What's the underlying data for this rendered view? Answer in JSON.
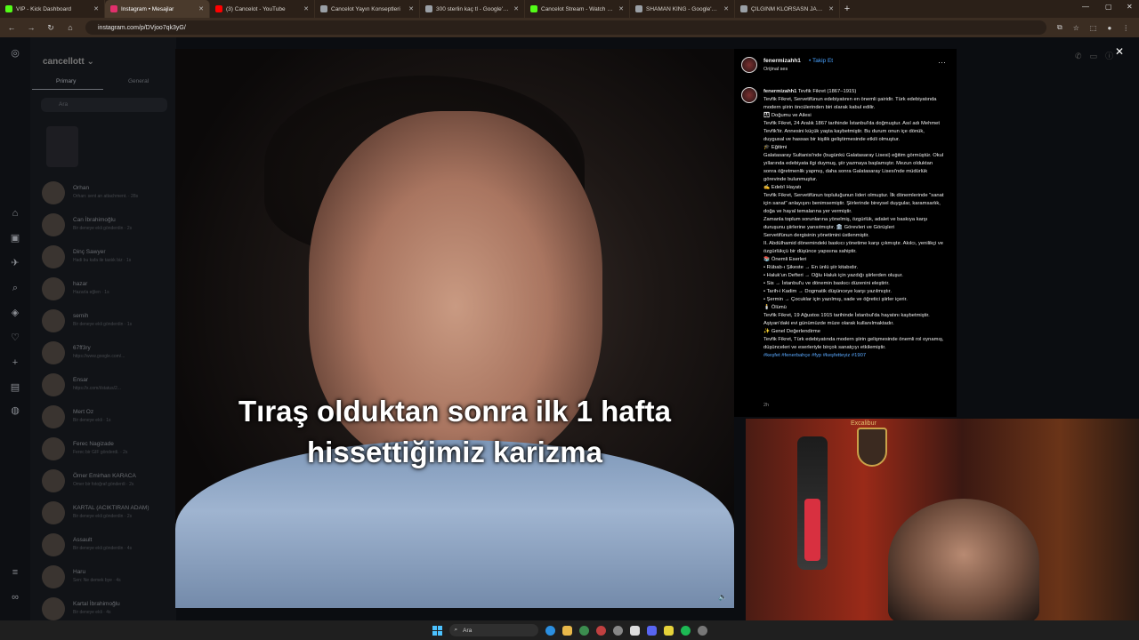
{
  "browser": {
    "tabs": [
      {
        "label": "VIP - Kick Dashboard",
        "color": "#53fc18"
      },
      {
        "label": "Instagram • Mesajlar",
        "color": "#e1306c",
        "active": true
      },
      {
        "label": "(3) Cancelot - YouTube",
        "color": "#ff0000"
      },
      {
        "label": "Cancelot Yayın Konseptleri",
        "color": "#9aa0a6"
      },
      {
        "label": "300 sterlin kaç tl - Google'da Ara",
        "color": "#9aa0a6"
      },
      {
        "label": "Cancelot Stream - Watch Live o",
        "color": "#53fc18"
      },
      {
        "label": "SHAMAN KING - Google'da Ara",
        "color": "#9aa0a6"
      },
      {
        "label": "ÇILGINM KLORSASN JACK - Go",
        "color": "#9aa0a6"
      }
    ],
    "url": "instagram.com/p/DVjoo7qk3yG/"
  },
  "dm": {
    "username": "cancellott",
    "tabs": [
      "Primary",
      "General"
    ],
    "search_placeholder": "Ara",
    "threads": [
      {
        "name": "Orhan",
        "sub": "Orhan: sent an attachment. · 28s"
      },
      {
        "name": "Can İbrahimoğlu",
        "sub": "Bir deneye ekli gönderdin · 2s"
      },
      {
        "name": "Dinç Sawyer",
        "sub": "Hadi bu kafa ile tastık biz · 1s"
      },
      {
        "name": "hazar",
        "sub": "Hazarla eğlen · 1s"
      },
      {
        "name": "semih",
        "sub": "Bir deneye ekli gönderdin · 1s"
      },
      {
        "name": "67ff3ry",
        "sub": "https://www.google.com/..."
      },
      {
        "name": "Ensar",
        "sub": "https://x.com/i/status/2..."
      },
      {
        "name": "Mert Oz",
        "sub": "Bir deneye ekli · 1s"
      },
      {
        "name": "Ferec Nagizade",
        "sub": "Ferec bir GIF gönderdi. · 2s"
      },
      {
        "name": "Ömer Emirhan KARACA",
        "sub": "Ömer bir fotoğraf gönderdi · 2s"
      },
      {
        "name": "KARTAL (ACIKTIRAN ADAM)",
        "sub": "Bir deneye ekli gönderdin · 2s"
      },
      {
        "name": "Assault",
        "sub": "Bir deneye ekli gönderdin · 4s"
      },
      {
        "name": "Haru",
        "sub": "Sen: Ne demek bye · 4s"
      },
      {
        "name": "Kartal İbrahimoğlu",
        "sub": "Bir deneye ekli · 4s"
      }
    ]
  },
  "video": {
    "caption": "Tıraş olduktan sonra ilk 1 hafta hissettiğimiz karizma"
  },
  "post": {
    "author": "fenermizahh1",
    "follow_label": "Takip Et",
    "audio": "Orijinal ses",
    "heading": "Tevfik Fikret (1867–1915)",
    "lines": [
      "Tevfik Fikret, Servetifünun edebiyatının en önemli şairidir. Türk edebiyatında modern şiirin öncülerinden biri olarak kabul edilir.",
      "👨‍👩‍👦 Doğumu ve Ailesi",
      "Tevfik Fikret, 24 Aralık 1867 tarihinde İstanbul'da doğmuştur. Asıl adı Mehmet Tevfik'tir. Annesini küçük yaşta kaybetmiştir. Bu durum onun içe dönük, duygusal ve hassas bir kişilik geliştirmesinde etkili olmuştur.",
      "🎓 Eğitimi",
      "Galatasaray Sultanisi'nde (bugünkü Galatasaray Lisesi) eğitim görmüştür. Okul yıllarında edebiyata ilgi duymuş, şiir yazmaya başlamıştır. Mezun olduktan sonra öğretmenlik yapmış, daha sonra Galatasaray Lisesi'nde müdürlük görevinde bulunmuştur.",
      "✍️ Edebî Hayatı",
      "Tevfik Fikret, Servetifünun topluluğunun lideri olmuştur. İlk dönemlerinde \"sanat için sanat\" anlayışını benimsemiştir. Şiirlerinde bireysel duygular, karamsarlık, doğa ve hayal temalarına yer vermiştir.",
      "Zamanla toplum sorunlarına yönelmiş, özgürlük, adalet ve baskıya karşı duruşunu şiirlerine yansıtmıştır. 🏛️ Görevleri ve Görüşleri",
      "Servetifünun dergisinin yönetimini üstlenmiştir.",
      "II. Abdülhamid dönemindeki baskıcı yönetime karşı çıkmıştır. Akılcı, yenilikçi ve özgürlükçü bir düşünce yapısına sahiptir.",
      "📚 Önemli Eserleri",
      "• Rübab-ı Şikeste → En ünlü şiir kitabıdır.",
      "• Haluk'un Defteri → Oğlu Haluk için yazdığı şiirlerden oluşur.",
      "• Sis → İstanbul'u ve dönemin baskıcı düzenini eleştirir.",
      "• Tarih-i Kadim → Dogmatik düşünceye karşı yazılmıştır.",
      "• Şermin → Çocuklar için yazılmış, sade ve öğretici şiirler içerir.",
      "🕯️ Ölümü",
      "Tevfik Fikret, 19 Ağustos 1915 tarihinde İstanbul'da hayatını kaybetmiştir. Aşiyan'daki evi günümüzde müze olarak kullanılmaktadır.",
      "✨ Genel Değerlendirme",
      "Tevfik Fikret, Türk edebiyatında modern şiirin gelişmesinde önemli rol oynamış, düşünceleri ve eserleriyle birçok sanatçıyı etkilemiştir."
    ],
    "hashtags": "#keşfet #fenerbahçe #fyp #keşfetteyiz #1907",
    "time": "2h"
  },
  "webcam": {
    "sign": "Excalibur"
  },
  "taskbar": {
    "search_placeholder": "Ara"
  }
}
